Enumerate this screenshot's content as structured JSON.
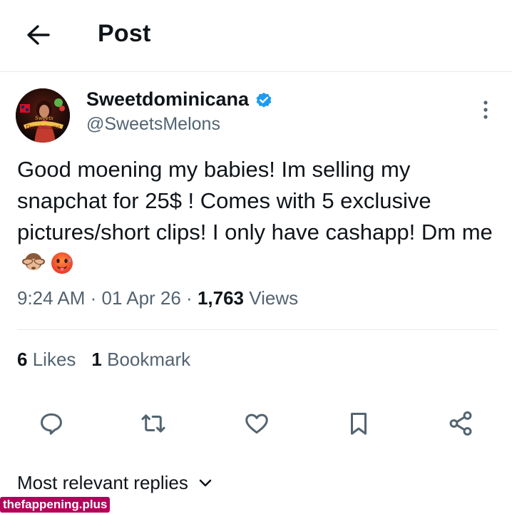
{
  "header": {
    "title": "Post",
    "back_icon": "arrow-left-icon"
  },
  "author": {
    "name": "Sweetdominicana",
    "handle": "@SweetsMelons",
    "verified_icon": "verified-badge-icon",
    "verified_color": "#1d9bf0",
    "avatar_text": "Sweets Dominicana"
  },
  "tweet": {
    "text": "Good moening my babies! Im selling my snapchat for 25$ ! Comes with 5 exclusive pictures/short clips! I only have cashapp! Dm me",
    "emojis": [
      "see-no-evil-monkey-emoji",
      "hot-face-emoji"
    ]
  },
  "meta": {
    "time": "9:24 AM",
    "date": "01 Apr 26",
    "separator": " · ",
    "views_count": "1,763",
    "views_label": "Views"
  },
  "stats": {
    "likes_count": "6",
    "likes_label": "Likes",
    "bookmarks_count": "1",
    "bookmarks_label": "Bookmark"
  },
  "actions": [
    "reply-icon",
    "retweet-icon",
    "like-icon",
    "bookmark-icon",
    "share-icon"
  ],
  "replies_sort": {
    "label": "Most relevant replies",
    "icon": "chevron-down-icon"
  },
  "watermark": "thefappening.plus",
  "colors": {
    "text": "#0f1419",
    "secondary": "#536471",
    "divider": "#e6e9ec",
    "watermark_bg": "#b4005a"
  }
}
